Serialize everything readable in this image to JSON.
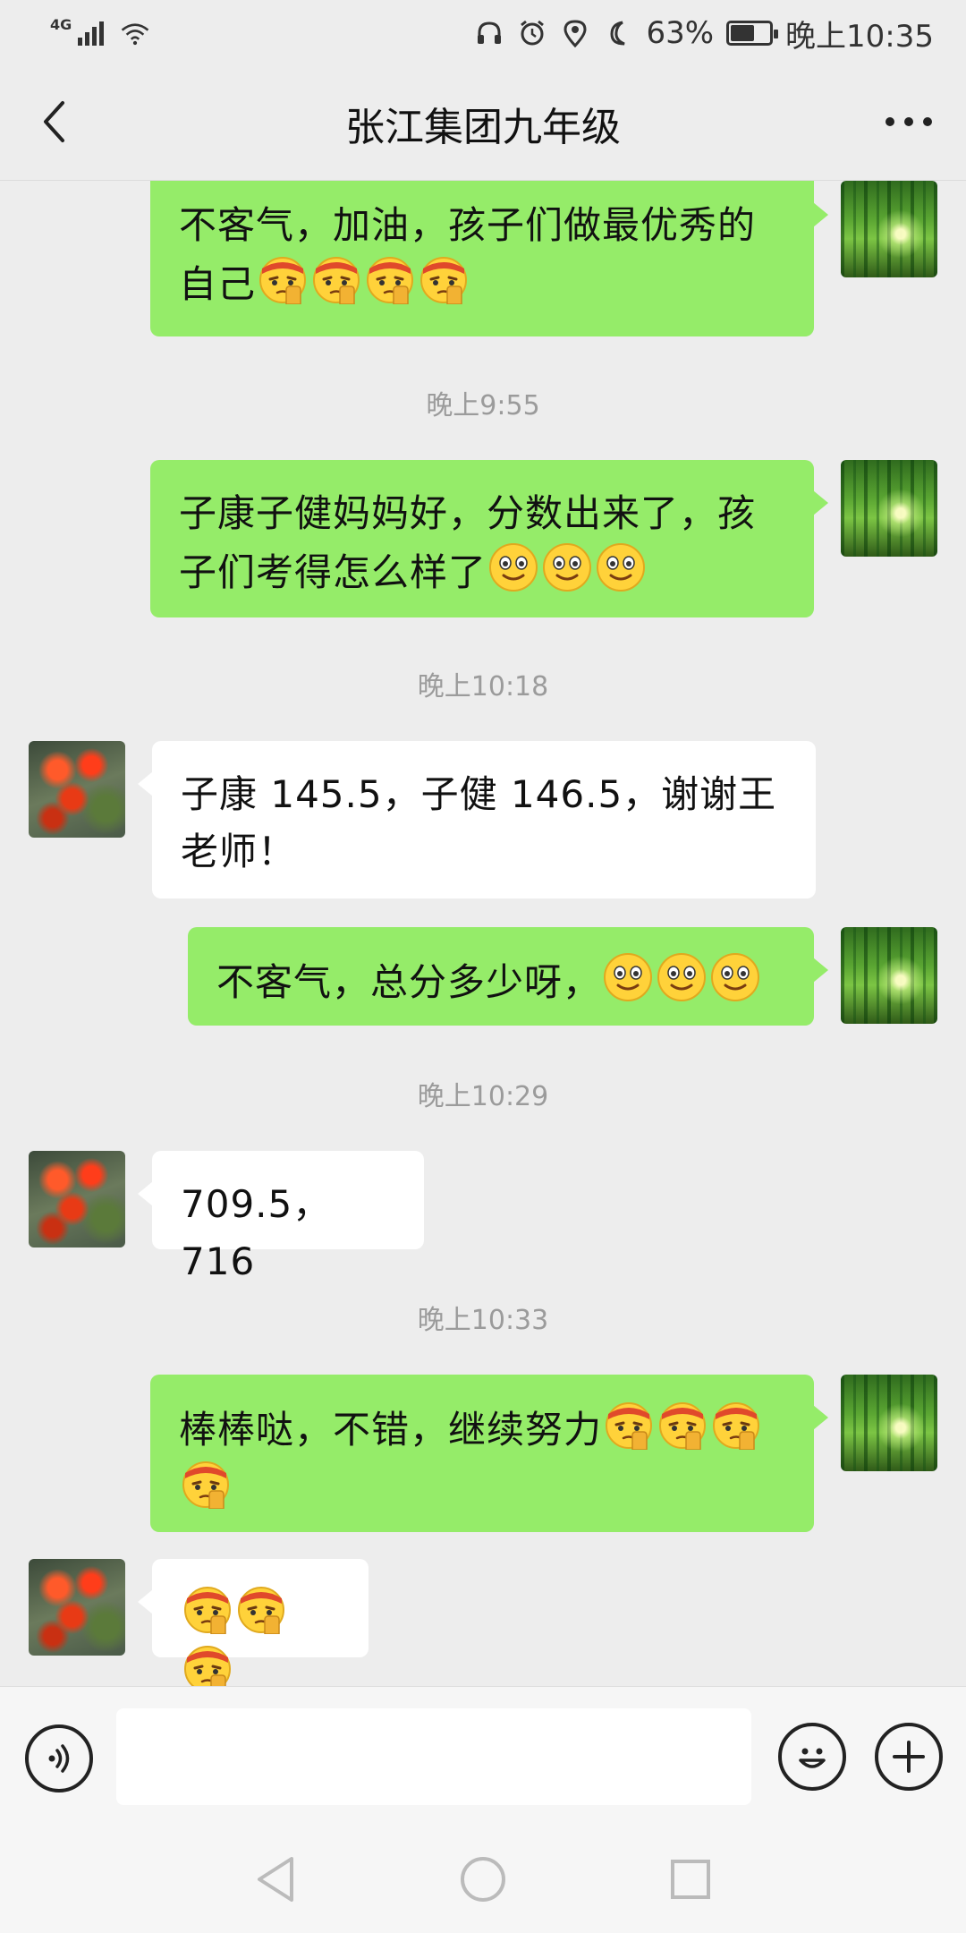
{
  "status_bar": {
    "network": "4G",
    "battery_percent": "63%",
    "battery_level": 0.63,
    "time": "晚上10:35"
  },
  "header": {
    "title": "张江集团九年级"
  },
  "messages": [
    {
      "side": "right",
      "text": "不客气，加油，孩子们做最优秀的",
      "text2": "自己",
      "emoji": "salute-face",
      "emoji_count": 4
    },
    {
      "time": "晚上9:55"
    },
    {
      "side": "right",
      "text": "子康子健妈妈好，分数出来了，孩",
      "text2": "子们考得怎么样了",
      "emoji": "smile-face",
      "emoji_count": 3
    },
    {
      "time": "晚上10:18"
    },
    {
      "side": "left",
      "text": "子康 145.5，子健 146.5，谢谢王",
      "text2": "老师！"
    },
    {
      "side": "right",
      "text": "不客气，总分多少呀，",
      "emoji": "smile-face",
      "emoji_count": 3
    },
    {
      "time": "晚上10:29"
    },
    {
      "side": "left",
      "text": "709.5，716"
    },
    {
      "time": "晚上10:33"
    },
    {
      "side": "right",
      "text": "棒棒哒，不错，继续努力",
      "emoji": "salute-face",
      "emoji_count": 4
    },
    {
      "side": "left",
      "emoji": "salute-face",
      "emoji_count": 3
    }
  ],
  "input": {
    "value": "",
    "placeholder": ""
  },
  "icons": {
    "back": "chevron-left-icon",
    "more": "more-dots-icon",
    "voice": "voice-icon",
    "emoji": "emoji-icon",
    "plus": "plus-icon",
    "sys_back": "triangle-back-icon",
    "sys_home": "circle-home-icon",
    "sys_recent": "square-recent-icon"
  },
  "colors": {
    "bg": "#ededed",
    "bubble_self": "#95ec69",
    "bubble_other": "#ffffff",
    "timestamp": "#9b9b9b"
  }
}
